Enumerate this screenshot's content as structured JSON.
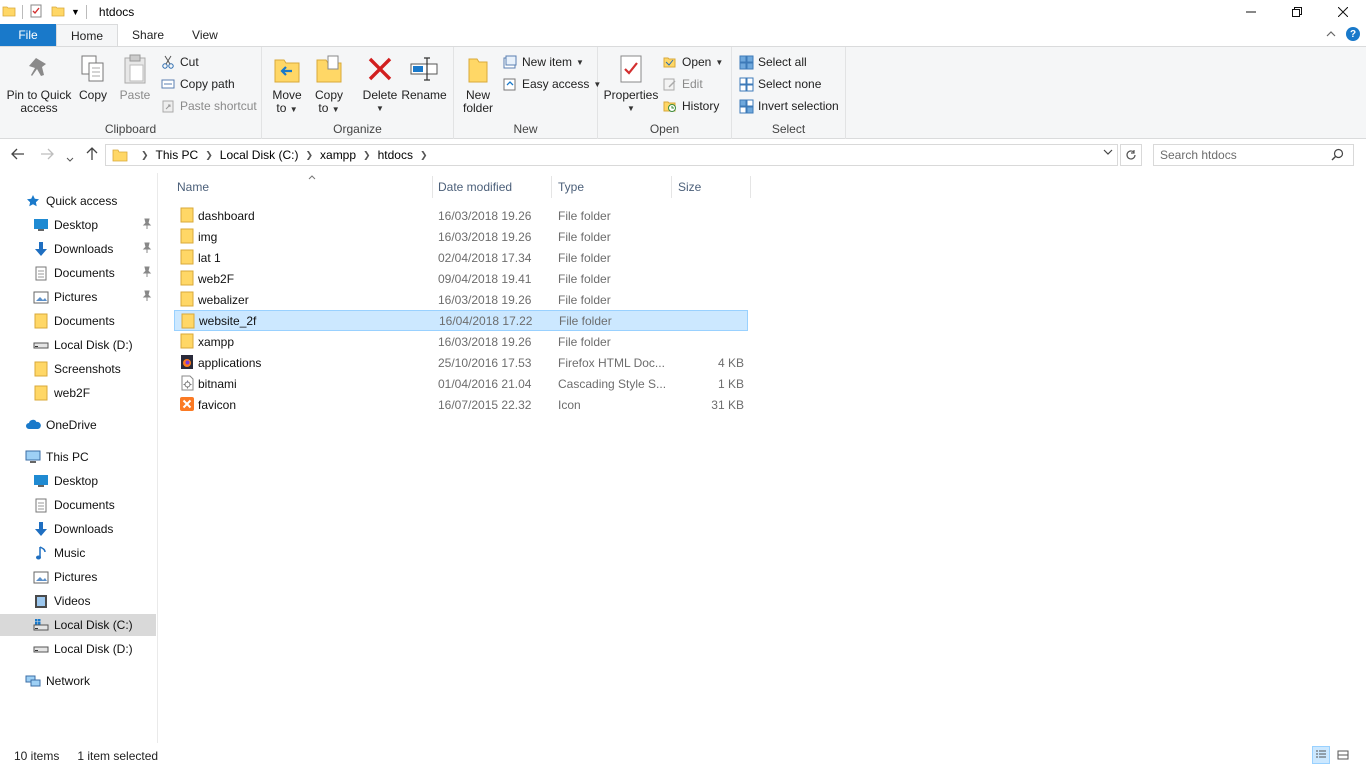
{
  "window": {
    "title": "htdocs"
  },
  "tabs": {
    "file": "File",
    "home": "Home",
    "share": "Share",
    "view": "View"
  },
  "ribbon": {
    "clipboard": {
      "label": "Clipboard",
      "pin_line1": "Pin to Quick",
      "pin_line2": "access",
      "copy": "Copy",
      "paste": "Paste",
      "cut": "Cut",
      "copy_path": "Copy path",
      "paste_shortcut": "Paste shortcut"
    },
    "organize": {
      "label": "Organize",
      "move_line1": "Move",
      "move_line2": "to",
      "copy_line1": "Copy",
      "copy_line2": "to",
      "delete": "Delete",
      "rename": "Rename"
    },
    "new": {
      "label": "New",
      "folder_line1": "New",
      "folder_line2": "folder",
      "new_item": "New item",
      "easy_access": "Easy access"
    },
    "open": {
      "label": "Open",
      "properties": "Properties",
      "open": "Open",
      "edit": "Edit",
      "history": "History"
    },
    "select": {
      "label": "Select",
      "select_all": "Select all",
      "select_none": "Select none",
      "invert": "Invert selection"
    }
  },
  "address": {
    "crumbs": [
      "This PC",
      "Local Disk (C:)",
      "xampp",
      "htdocs"
    ],
    "search_placeholder": "Search htdocs"
  },
  "nav": {
    "quick_access": "Quick access",
    "qa_items": [
      "Desktop",
      "Downloads",
      "Documents",
      "Pictures",
      "Documents",
      "Local Disk (D:)",
      "Screenshots",
      "web2F"
    ],
    "onedrive": "OneDrive",
    "this_pc": "This PC",
    "pc_items": [
      "Desktop",
      "Documents",
      "Downloads",
      "Music",
      "Pictures",
      "Videos",
      "Local Disk (C:)",
      "Local Disk (D:)"
    ],
    "network": "Network"
  },
  "columns": {
    "name": "Name",
    "date": "Date modified",
    "type": "Type",
    "size": "Size"
  },
  "files": [
    {
      "name": "dashboard",
      "date": "16/03/2018 19.26",
      "type": "File folder",
      "size": ""
    },
    {
      "name": "img",
      "date": "16/03/2018 19.26",
      "type": "File folder",
      "size": ""
    },
    {
      "name": "lat 1",
      "date": "02/04/2018 17.34",
      "type": "File folder",
      "size": ""
    },
    {
      "name": "web2F",
      "date": "09/04/2018 19.41",
      "type": "File folder",
      "size": ""
    },
    {
      "name": "webalizer",
      "date": "16/03/2018 19.26",
      "type": "File folder",
      "size": ""
    },
    {
      "name": "website_2f",
      "date": "16/04/2018 17.22",
      "type": "File folder",
      "size": ""
    },
    {
      "name": "xampp",
      "date": "16/03/2018 19.26",
      "type": "File folder",
      "size": ""
    },
    {
      "name": "applications",
      "date": "25/10/2016 17.53",
      "type": "Firefox HTML Doc...",
      "size": "4 KB"
    },
    {
      "name": "bitnami",
      "date": "01/04/2016 21.04",
      "type": "Cascading Style S...",
      "size": "1 KB"
    },
    {
      "name": "favicon",
      "date": "16/07/2015 22.32",
      "type": "Icon",
      "size": "31 KB"
    }
  ],
  "status": {
    "items": "10 items",
    "selected": "1 item selected"
  },
  "colors": {
    "accent": "#1979ca",
    "selection": "#cce8ff",
    "folder": "#ffd766"
  }
}
